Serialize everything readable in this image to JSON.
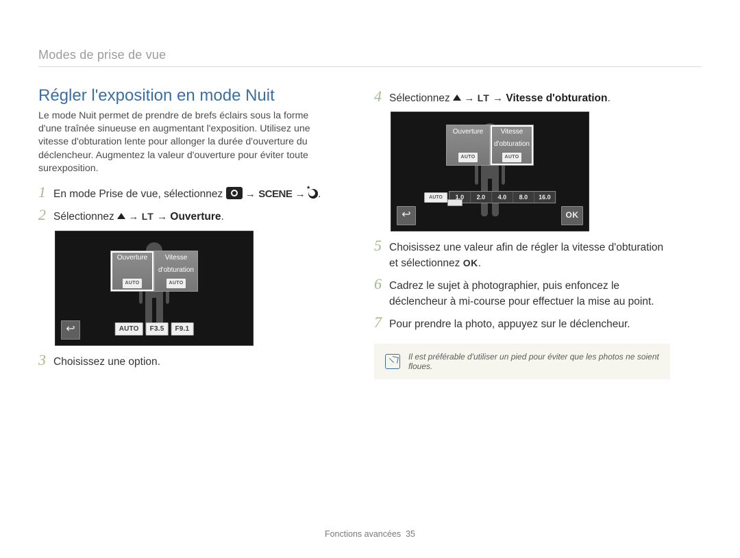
{
  "breadcrumb": "Modes de prise de vue",
  "title": "Régler l'exposition en mode Nuit",
  "intro": "Le mode Nuit permet de prendre de brefs éclairs sous la forme d'une traînée sinueuse en augmentant l'exposition. Utilisez une vitesse d'obturation lente pour allonger la durée d'ouverture du déclencheur. Augmentez la valeur d'ouverture pour éviter toute surexposition.",
  "steps": {
    "s1": {
      "num": "1",
      "pre": "En mode Prise de vue, sélectionnez ",
      "post": "."
    },
    "s2": {
      "num": "2",
      "pre": "Sélectionnez ",
      "label": "Ouverture",
      "post": "."
    },
    "s3": {
      "num": "3",
      "text": "Choisissez une option."
    },
    "s4": {
      "num": "4",
      "pre": "Sélectionnez ",
      "label": "Vitesse d'obturation",
      "post": "."
    },
    "s5": {
      "num": "5",
      "text": "Choisissez une valeur afin de régler la vitesse d'obturation et sélectionnez "
    },
    "s6": {
      "num": "6",
      "text": "Cadrez le sujet à photographier, puis enfoncez le déclencheur à mi-course pour effectuer la mise au point."
    },
    "s7": {
      "num": "7",
      "text": "Pour prendre la photo, appuyez sur le déclencheur."
    }
  },
  "camshot1": {
    "tile_ouverture": "Ouverture",
    "tile_vitesse_l1": "Vitesse",
    "tile_vitesse_l2": "d'obturation",
    "auto_label": "AUTO",
    "vals": [
      "AUTO",
      "F3.5",
      "F9.1"
    ]
  },
  "camshot2": {
    "tile_ouverture": "Ouverture",
    "tile_vitesse_l1": "Vitesse",
    "tile_vitesse_l2": "d'obturation",
    "auto_label": "AUTO",
    "scale_auto": "AUTO",
    "scale": [
      "1.0",
      "2.0",
      "4.0",
      "8.0",
      "16.0"
    ],
    "ok": "OK"
  },
  "icons": {
    "arrow": "→",
    "lt": "LT",
    "scene": "SCENE",
    "ok_inline": "OK",
    "back": "↩"
  },
  "note": "Il est préférable d'utiliser un pied pour éviter que les photos ne soient floues.",
  "footer_label": "Fonctions avancées",
  "footer_page": "35"
}
